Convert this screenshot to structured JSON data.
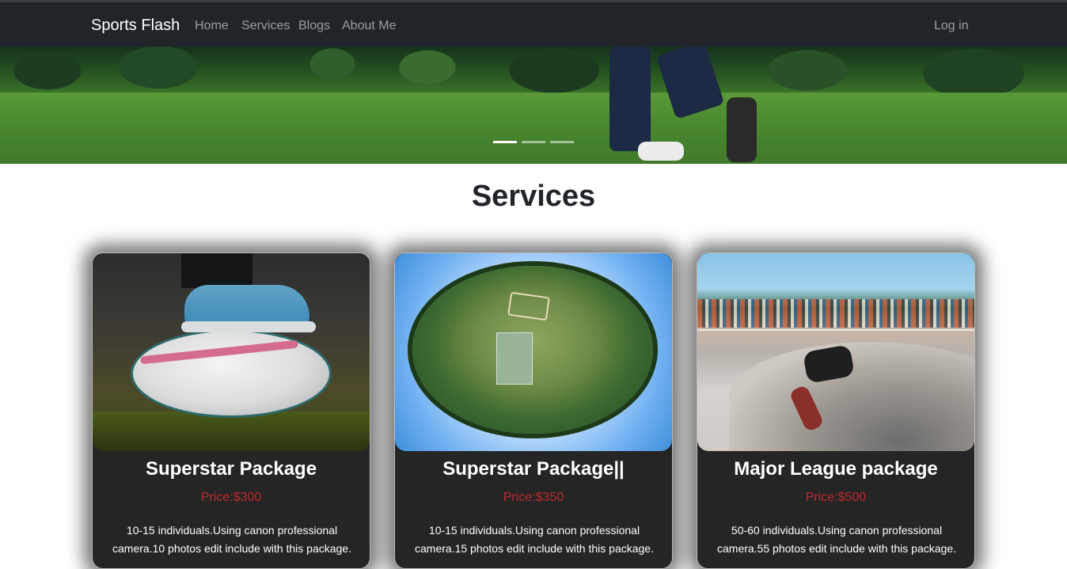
{
  "nav": {
    "brand": "Sports Flash",
    "links": [
      "Home",
      "Services",
      "Blogs",
      "About Me"
    ],
    "login": "Log in"
  },
  "carousel": {
    "slide_count": 3,
    "active_index": 0
  },
  "services": {
    "title": "Services",
    "cards": [
      {
        "title": "Superstar Package",
        "price": "Price:$300",
        "description": "10-15 individuals.Using canon professional camera.10 photos edit include with this package."
      },
      {
        "title": "Superstar Package||",
        "price": "Price:$350",
        "description": "10-15 individuals.Using canon professional camera.15 photos edit include with this package."
      },
      {
        "title": "Major League package",
        "price": "Price:$500",
        "description": "50-60 individuals.Using canon professional camera.55 photos edit include with this package."
      }
    ]
  },
  "colors": {
    "navbar": "#212529",
    "card_bg": "#252525",
    "price": "#c0272d"
  }
}
